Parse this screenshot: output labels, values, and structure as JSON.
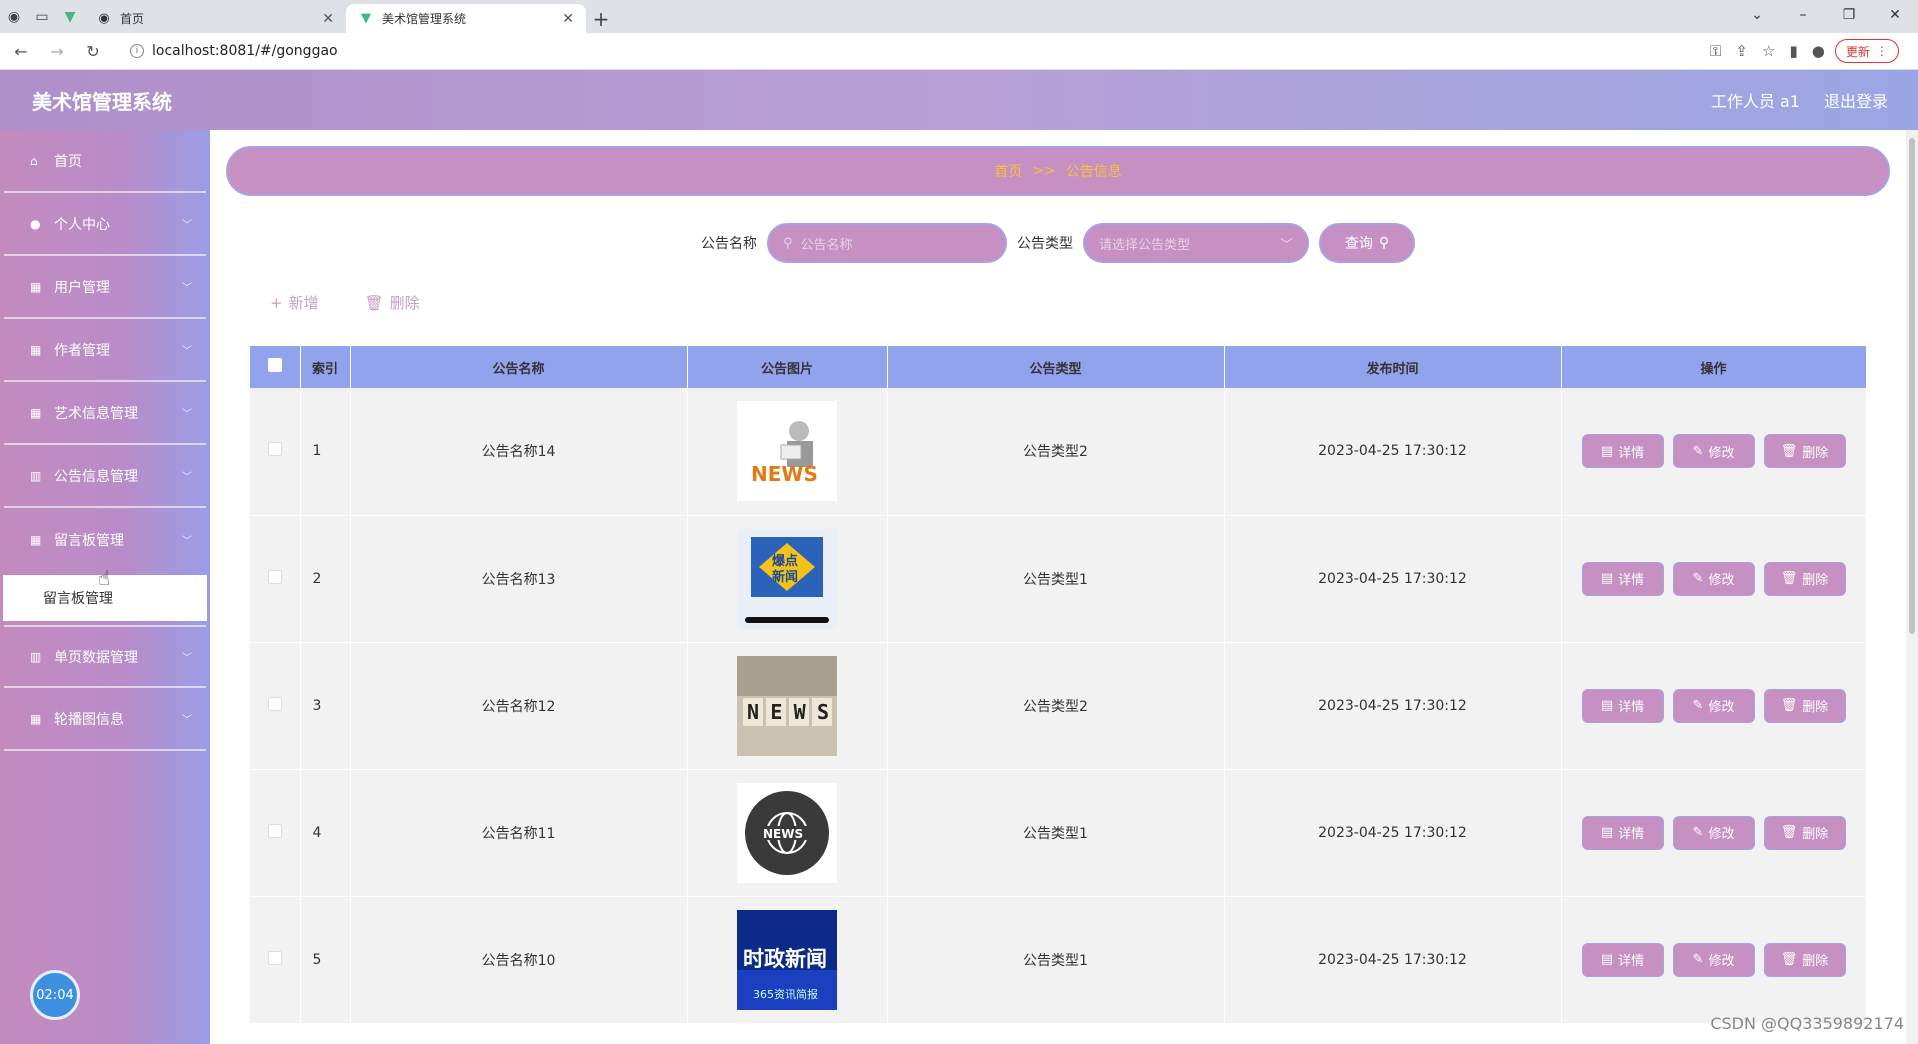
{
  "browser": {
    "tabs": [
      {
        "title": "首页",
        "active": false
      },
      {
        "title": "美术馆管理系统",
        "active": true
      }
    ],
    "url": "localhost:8081/#/gonggao",
    "update_label": "更新"
  },
  "header": {
    "app_title": "美术馆管理系统",
    "user_label": "工作人员 a1",
    "logout_label": "退出登录"
  },
  "sidebar": {
    "items": [
      {
        "label": "首页",
        "icon": "home-icon",
        "expandable": false
      },
      {
        "label": "个人中心",
        "icon": "user-icon",
        "expandable": true
      },
      {
        "label": "用户管理",
        "icon": "grid-icon",
        "expandable": true
      },
      {
        "label": "作者管理",
        "icon": "grid-icon",
        "expandable": true
      },
      {
        "label": "艺术信息管理",
        "icon": "grid-icon",
        "expandable": true
      },
      {
        "label": "公告信息管理",
        "icon": "chart-icon",
        "expandable": true
      },
      {
        "label": "留言板管理",
        "icon": "grid-icon",
        "expandable": true,
        "expanded": true
      }
    ],
    "submenu_label": "留言板管理",
    "items_after": [
      {
        "label": "单页数据管理",
        "icon": "chart-icon",
        "expandable": true
      },
      {
        "label": "轮播图信息",
        "icon": "grid-icon",
        "expandable": true
      }
    ],
    "timer": "02:04"
  },
  "breadcrumb": {
    "home": "首页",
    "separator": ">>",
    "current": "公告信息"
  },
  "search": {
    "name_label": "公告名称",
    "name_placeholder": "公告名称",
    "type_label": "公告类型",
    "type_placeholder": "请选择公告类型",
    "query_label": "查询"
  },
  "actions": {
    "add_label": "新增",
    "delete_label": "删除"
  },
  "table": {
    "columns": [
      "索引",
      "公告名称",
      "公告图片",
      "公告类型",
      "发布时间",
      "操作"
    ],
    "op_labels": {
      "detail": "详情",
      "edit": "修改",
      "delete": "删除"
    },
    "rows": [
      {
        "index": "1",
        "name": "公告名称14",
        "image": "news-reader-image",
        "type": "公告类型2",
        "time": "2023-04-25 17:30:12"
      },
      {
        "index": "2",
        "name": "公告名称13",
        "image": "breaking-news-image",
        "type": "公告类型1",
        "time": "2023-04-25 17:30:12"
      },
      {
        "index": "3",
        "name": "公告名称12",
        "image": "news-blocks-image",
        "type": "公告类型2",
        "time": "2023-04-25 17:30:12"
      },
      {
        "index": "4",
        "name": "公告名称11",
        "image": "news-globe-image",
        "type": "公告类型1",
        "time": "2023-04-25 17:30:12"
      },
      {
        "index": "5",
        "name": "公告名称10",
        "image": "politics-news-image",
        "type": "公告类型1",
        "time": "2023-04-25 17:30:12"
      }
    ]
  },
  "thumb_text": {
    "news": "NEWS",
    "breaking_line1": "爆点",
    "breaking_line2": "新闻",
    "politics_line1": "时政新闻",
    "politics_line2": "365资讯简报"
  },
  "watermark": "CSDN @QQ3359892174",
  "colors": {
    "header_gradient_start": "#b08fc9",
    "sidebar": "#c38bbd",
    "pill": "#c690c2",
    "pill_border": "#a7a2e6",
    "table_header": "#91a3ed",
    "breadcrumb_text": "#f3c23f"
  }
}
